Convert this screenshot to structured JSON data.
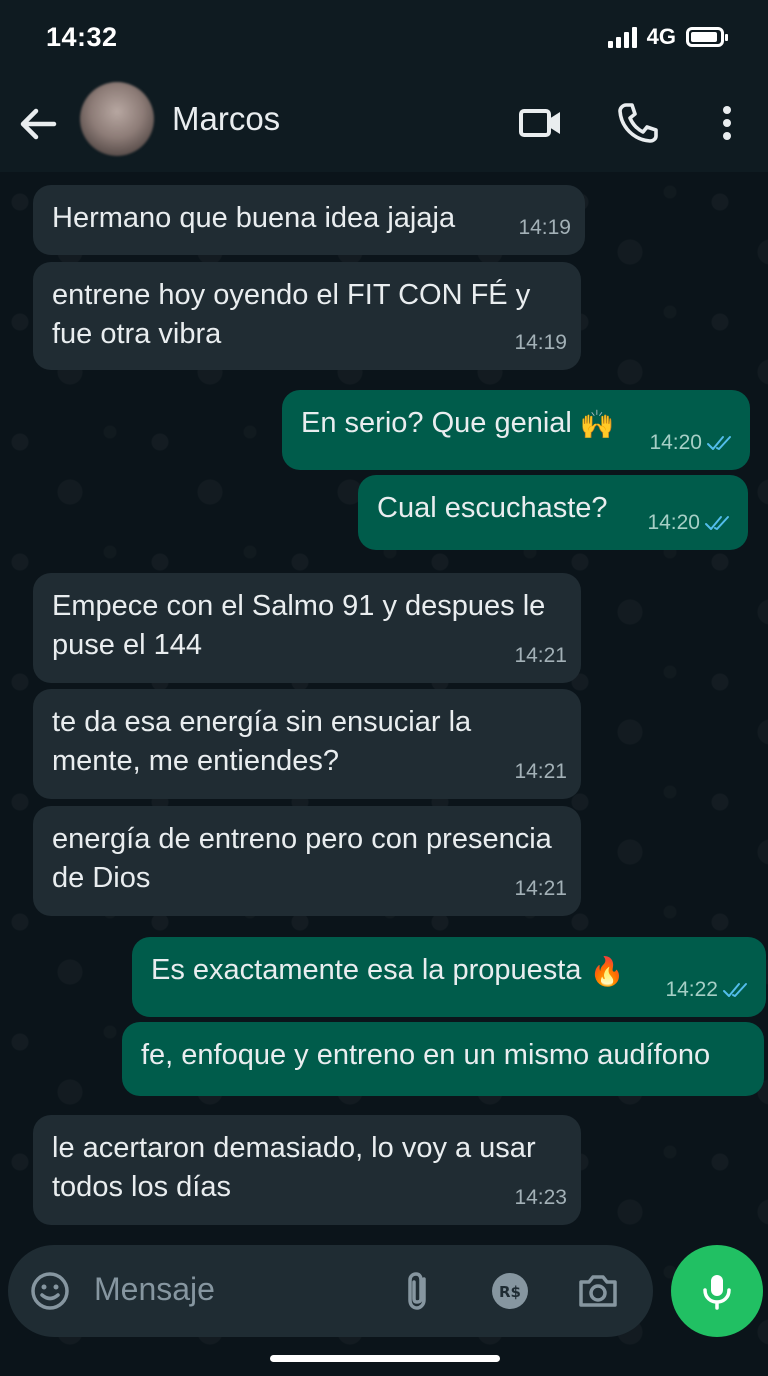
{
  "status_bar": {
    "time": "14:32",
    "network": "4G"
  },
  "header": {
    "contact_name": "Marcos"
  },
  "messages": [
    {
      "direction": "in",
      "text": "Hermano que buena idea jajaja",
      "time": "14:19"
    },
    {
      "direction": "in",
      "text": "entrene hoy oyendo el FIT CON FÉ y fue otra vibra",
      "time": "14:19"
    },
    {
      "direction": "out",
      "text": "En serio? Que genial",
      "emoji": "🙌",
      "time": "14:20",
      "status": "read"
    },
    {
      "direction": "out",
      "text": "Cual escuchaste?",
      "time": "14:20",
      "status": "read"
    },
    {
      "direction": "in",
      "text": "Empece con el Salmo 91 y despues le puse el 144",
      "time": "14:21"
    },
    {
      "direction": "in",
      "text": "te da esa energía sin ensuciar la mente, me entiendes?",
      "time": "14:21"
    },
    {
      "direction": "in",
      "text": "energía de entreno pero con presencia de Dios",
      "time": "14:21"
    },
    {
      "direction": "out",
      "text": "Es exactamente esa la propuesta",
      "emoji": "🔥",
      "time": "14:22",
      "status": "read"
    },
    {
      "direction": "out",
      "text": "fe, enfoque y entreno en un mismo audífono"
    },
    {
      "direction": "in",
      "text": "le acertaron demasiado, lo voy a usar todos los días",
      "time": "14:23"
    }
  ],
  "composer": {
    "placeholder": "Mensaje"
  },
  "colors": {
    "accent": "#21c063",
    "outgoing_bubble": "#005c4b",
    "incoming_bubble": "#202c33",
    "read_ticks": "#53bdeb"
  }
}
